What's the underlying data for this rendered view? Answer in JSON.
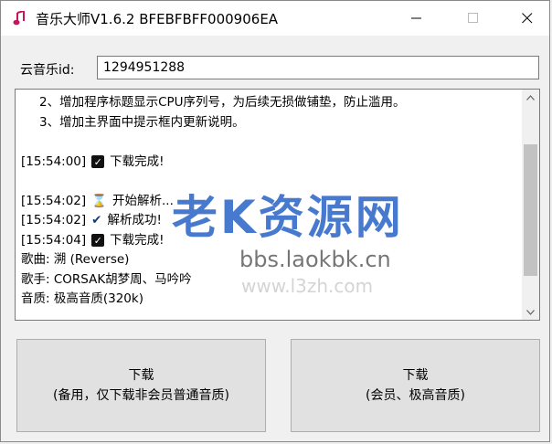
{
  "window": {
    "title": "音乐大师V1.6.2 BFEBFBFF000906EA",
    "icon": "music-note-icon",
    "accent_color": "#c2185b"
  },
  "form": {
    "id_label": "云音乐id:",
    "id_value": "1294951288"
  },
  "log": {
    "lines": [
      {
        "indent": true,
        "text": "2、增加程序标题显示CPU序列号，为后续无损做铺垫，防止滥用。"
      },
      {
        "indent": true,
        "text": "3、增加主界面中提示框内更新说明。"
      },
      {
        "blank": true
      },
      {
        "time": "[15:54:00]",
        "icon": "check-box-icon",
        "text": "下载完成!"
      },
      {
        "blank": true
      },
      {
        "time": "[15:54:02]",
        "icon": "hourglass-icon",
        "text": "开始解析..."
      },
      {
        "time": "[15:54:02]",
        "icon": "checkmark-icon",
        "text": "解析成功!"
      },
      {
        "time": "[15:54:04]",
        "icon": "check-box-icon",
        "text": "下载完成!"
      },
      {
        "text": "歌曲: 溯 (Reverse)"
      },
      {
        "text": "歌手: CORSAK胡梦周、马吟吟"
      },
      {
        "text": "音质: 极高音质(320k)"
      }
    ]
  },
  "watermark": {
    "main": "老K资源网",
    "url": "bbs.laokbk.cn",
    "url2": "www.l3zh.com"
  },
  "buttons": {
    "download_backup_title": "下载",
    "download_backup_sub": "(备用，仅下载非会员普通音质)",
    "download_vip_title": "下载",
    "download_vip_sub": "(会员、极高音质)"
  }
}
